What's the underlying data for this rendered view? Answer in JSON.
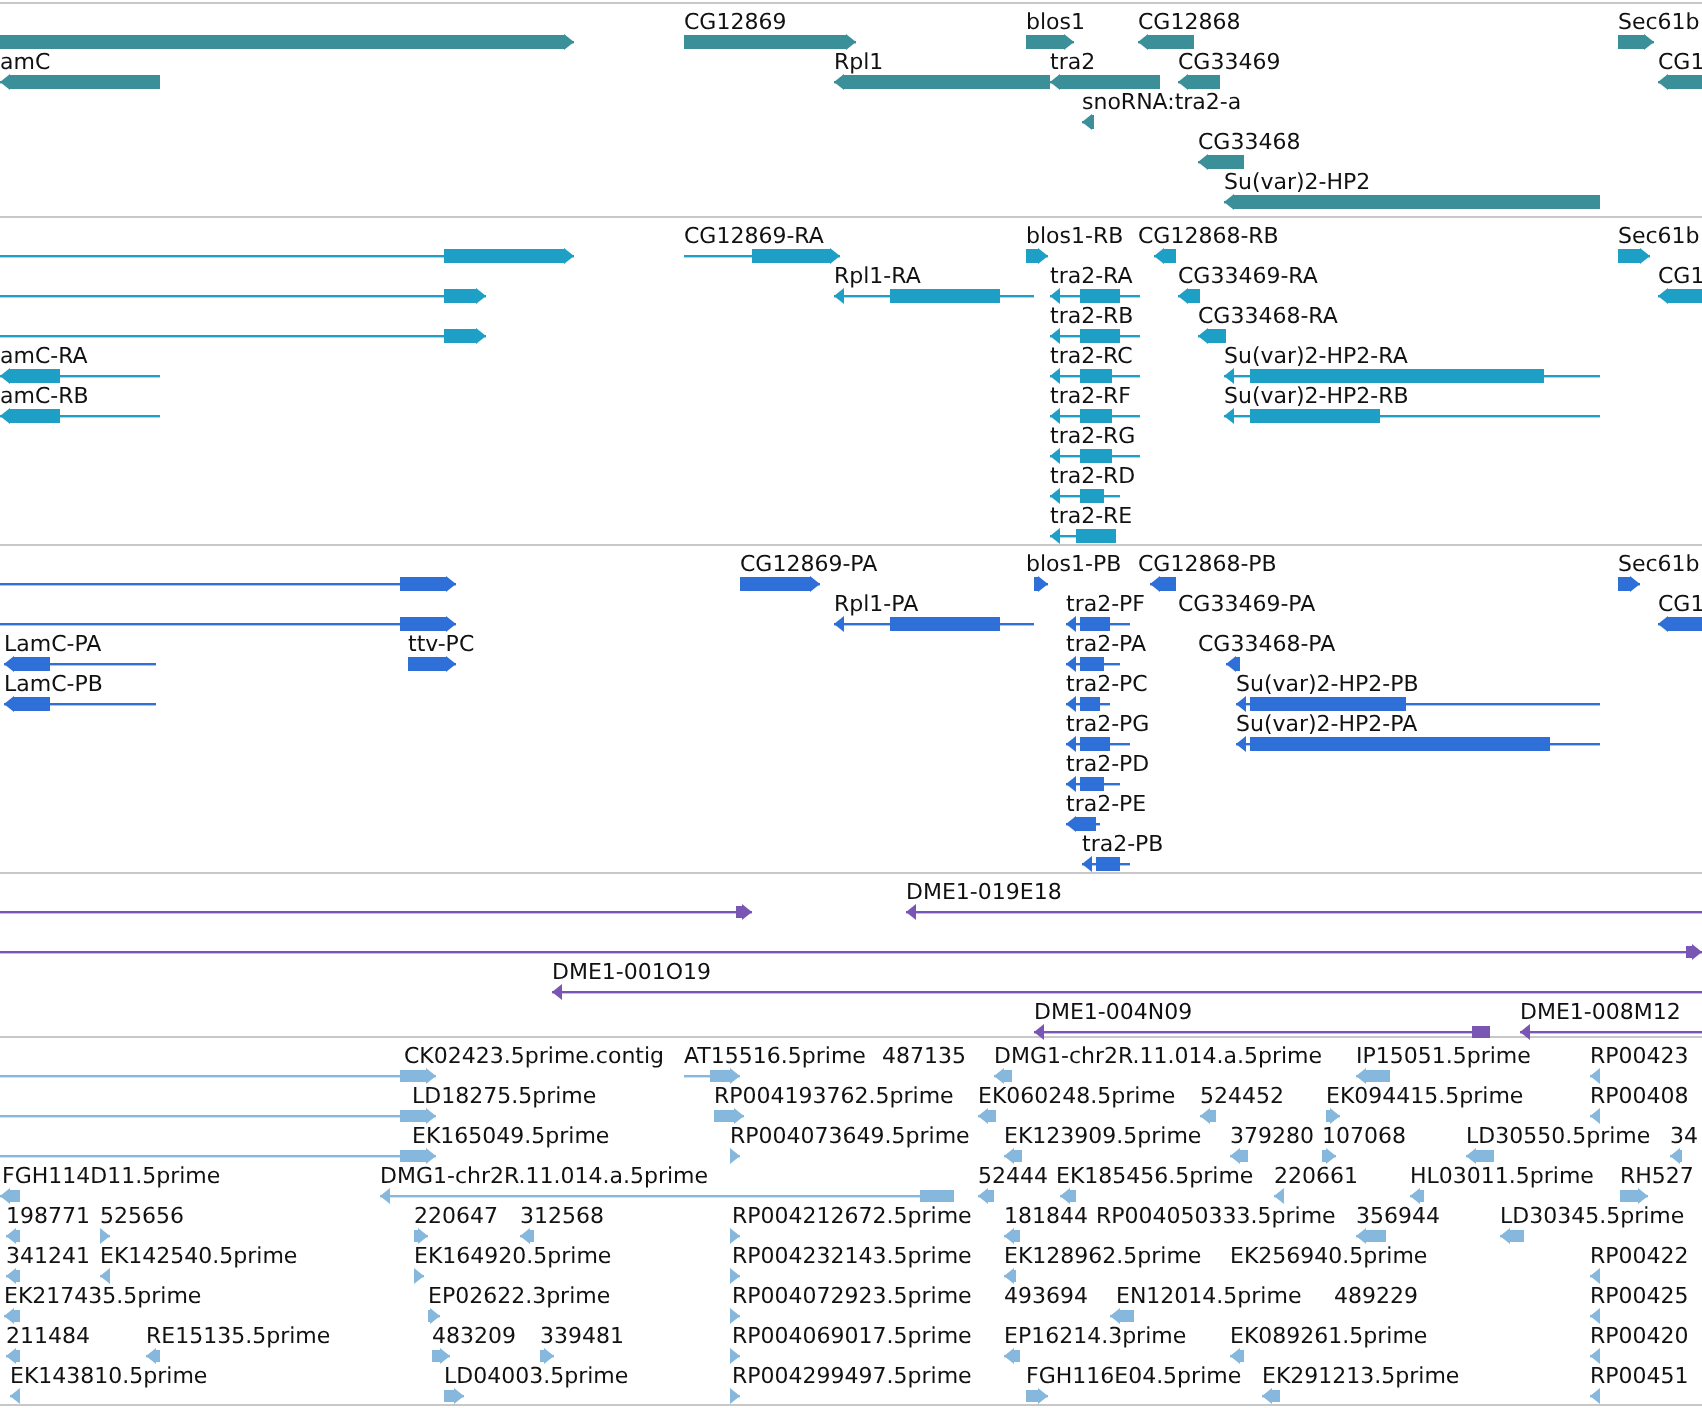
{
  "tracks": [
    {
      "kind": "gene",
      "color": "#3a8f98",
      "features": [
        {
          "forward": true
        },
        {
          "label": "CG12869",
          "forward": true
        },
        {
          "label": "blos1",
          "forward": true
        },
        {
          "label": "CG12868",
          "forward": false
        },
        {
          "label": "Sec61b",
          "forward": true
        },
        {
          "label": "amC",
          "forward": false
        },
        {
          "label": "Rpl1",
          "forward": false
        },
        {
          "label": "tra2",
          "forward": false
        },
        {
          "label": "CG33469",
          "forward": false
        },
        {
          "label": "CG1",
          "forward": false
        },
        {
          "label": "snoRNA:tra2-a",
          "forward": false
        },
        {
          "label": "CG33468",
          "forward": false
        },
        {
          "label": "Su(var)2-HP2",
          "forward": false
        }
      ]
    },
    {
      "kind": "transcript",
      "color": "#1e9fc6",
      "features": [
        {
          "forward": true
        },
        {
          "label": "CG12869-RA",
          "forward": true
        },
        {
          "label": "blos1-RB",
          "forward": true
        },
        {
          "label": "CG12868-RB",
          "forward": false
        },
        {
          "label": "Sec61b",
          "forward": true
        },
        {
          "forward": true
        },
        {
          "label": "Rpl1-RA",
          "forward": false
        },
        {
          "label": "tra2-RA",
          "forward": false
        },
        {
          "label": "CG33469-RA",
          "forward": false
        },
        {
          "label": "CG1",
          "forward": false
        },
        {
          "forward": true
        },
        {
          "label": "tra2-RB",
          "forward": false
        },
        {
          "label": "CG33468-RA",
          "forward": false
        },
        {
          "label": "amC-RA",
          "forward": false
        },
        {
          "label": "tra2-RC",
          "forward": false
        },
        {
          "label": "Su(var)2-HP2-RA",
          "forward": false
        },
        {
          "label": "amC-RB",
          "forward": false
        },
        {
          "label": "tra2-RF",
          "forward": false
        },
        {
          "label": "Su(var)2-HP2-RB",
          "forward": false
        },
        {
          "label": "tra2-RG",
          "forward": false
        },
        {
          "label": "tra2-RD",
          "forward": false
        },
        {
          "label": "tra2-RE",
          "forward": false
        }
      ]
    },
    {
      "kind": "protein",
      "color": "#2e6fd8",
      "features": [
        {
          "forward": true
        },
        {
          "label": "CG12869-PA",
          "forward": true
        },
        {
          "label": "blos1-PB",
          "forward": true
        },
        {
          "label": "CG12868-PB",
          "forward": false
        },
        {
          "label": "Sec61b",
          "forward": true
        },
        {
          "forward": true
        },
        {
          "label": "Rpl1-PA",
          "forward": false
        },
        {
          "label": "tra2-PF",
          "forward": false
        },
        {
          "label": "CG33469-PA"
        },
        {
          "label": "CG1",
          "forward": false
        },
        {
          "label": "LamC-PA",
          "forward": false
        },
        {
          "label": "ttv-PC",
          "forward": true
        },
        {
          "label": "tra2-PA",
          "forward": false
        },
        {
          "label": "CG33468-PA",
          "forward": false
        },
        {
          "label": "LamC-PB",
          "forward": false
        },
        {
          "label": "tra2-PC",
          "forward": false
        },
        {
          "label": "Su(var)2-HP2-PB",
          "forward": false
        },
        {
          "label": "tra2-PG",
          "forward": false
        },
        {
          "label": "Su(var)2-HP2-PA",
          "forward": false
        },
        {
          "label": "tra2-PD",
          "forward": false
        },
        {
          "label": "tra2-PE",
          "forward": false
        },
        {
          "label": "tra2-PB",
          "forward": false
        }
      ]
    },
    {
      "kind": "clone",
      "color": "#7a56b4",
      "features": [
        {
          "forward": true
        },
        {
          "label": "DME1-019E18",
          "forward": false
        },
        {
          "forward": true
        },
        {
          "label": "DME1-001O19",
          "forward": false
        },
        {
          "label": "DME1-004N09",
          "forward": false
        },
        {
          "label": "DME1-008M12",
          "forward": false
        }
      ]
    },
    {
      "kind": "est",
      "color": "#86b8de",
      "features": [
        {
          "label": "CK02423.5prime.contig",
          "forward": true
        },
        {
          "label": "AT15516.5prime",
          "forward": true
        },
        {
          "label": "487135"
        },
        {
          "label": "DMG1-chr2R.11.014.a.5prime",
          "forward": false
        },
        {
          "label": "IP15051.5prime",
          "forward": false
        },
        {
          "label": "RP00423",
          "forward": false
        },
        {
          "label": "LD18275.5prime",
          "forward": true
        },
        {
          "label": "RP004193762.5prime",
          "forward": true
        },
        {
          "label": "EK060248.5prime",
          "forward": false
        },
        {
          "label": "524452",
          "forward": false
        },
        {
          "label": "EK094415.5prime",
          "forward": true
        },
        {
          "label": "RP00408",
          "forward": false
        },
        {
          "label": "EK165049.5prime",
          "forward": true
        },
        {
          "label": "RP004073649.5prime",
          "forward": true
        },
        {
          "label": "EK123909.5prime",
          "forward": false
        },
        {
          "label": "379280",
          "forward": false
        },
        {
          "label": "107068",
          "forward": true
        },
        {
          "label": "LD30550.5prime",
          "forward": false
        },
        {
          "label": "34",
          "forward": false
        },
        {
          "label": "FGH114D11.5prime",
          "forward": false
        },
        {
          "label": "DMG1-chr2R.11.014.a.5prime",
          "forward": false
        },
        {
          "label": "52444",
          "forward": false
        },
        {
          "label": "EK185456.5prime",
          "forward": false
        },
        {
          "label": "220661",
          "forward": false
        },
        {
          "label": "HL03011.5prime",
          "forward": false
        },
        {
          "label": "RH527",
          "forward": true
        },
        {
          "label": "198771",
          "forward": false
        },
        {
          "label": "525656",
          "forward": true
        },
        {
          "label": "220647",
          "forward": true
        },
        {
          "label": "312568",
          "forward": false
        },
        {
          "label": "RP004212672.5prime",
          "forward": true
        },
        {
          "label": "181844",
          "forward": false
        },
        {
          "label": "RP004050333.5prime"
        },
        {
          "label": "356944",
          "forward": false
        },
        {
          "label": "LD30345.5prime",
          "forward": false
        },
        {
          "label": "341241",
          "forward": false
        },
        {
          "label": "EK142540.5prime",
          "forward": false
        },
        {
          "label": "EK164920.5prime",
          "forward": true
        },
        {
          "label": "RP004232143.5prime",
          "forward": true
        },
        {
          "label": "EK128962.5prime",
          "forward": false
        },
        {
          "label": "EK256940.5prime"
        },
        {
          "label": "RP00422",
          "forward": false
        },
        {
          "label": "EK217435.5prime",
          "forward": false
        },
        {
          "label": "EP02622.3prime",
          "forward": true
        },
        {
          "label": "RP004072923.5prime",
          "forward": true
        },
        {
          "label": "493694"
        },
        {
          "label": "EN12014.5prime",
          "forward": false
        },
        {
          "label": "489229"
        },
        {
          "label": "RP00425",
          "forward": false
        },
        {
          "label": "211484",
          "forward": false
        },
        {
          "label": "RE15135.5prime",
          "forward": false
        },
        {
          "label": "483209",
          "forward": true
        },
        {
          "label": "339481",
          "forward": true
        },
        {
          "label": "RP004069017.5prime",
          "forward": true
        },
        {
          "label": "EP16214.3prime",
          "forward": false
        },
        {
          "label": "EK089261.5prime",
          "forward": false
        },
        {
          "label": "RP00420",
          "forward": false
        },
        {
          "label": "EK143810.5prime",
          "forward": false
        },
        {
          "label": "LD04003.5prime",
          "forward": true
        },
        {
          "label": "RP004299497.5prime",
          "forward": true
        },
        {
          "label": "FGH116E04.5prime",
          "forward": true
        },
        {
          "label": "EK291213.5prime",
          "forward": false
        },
        {
          "label": "RP00451",
          "forward": false
        }
      ]
    }
  ]
}
